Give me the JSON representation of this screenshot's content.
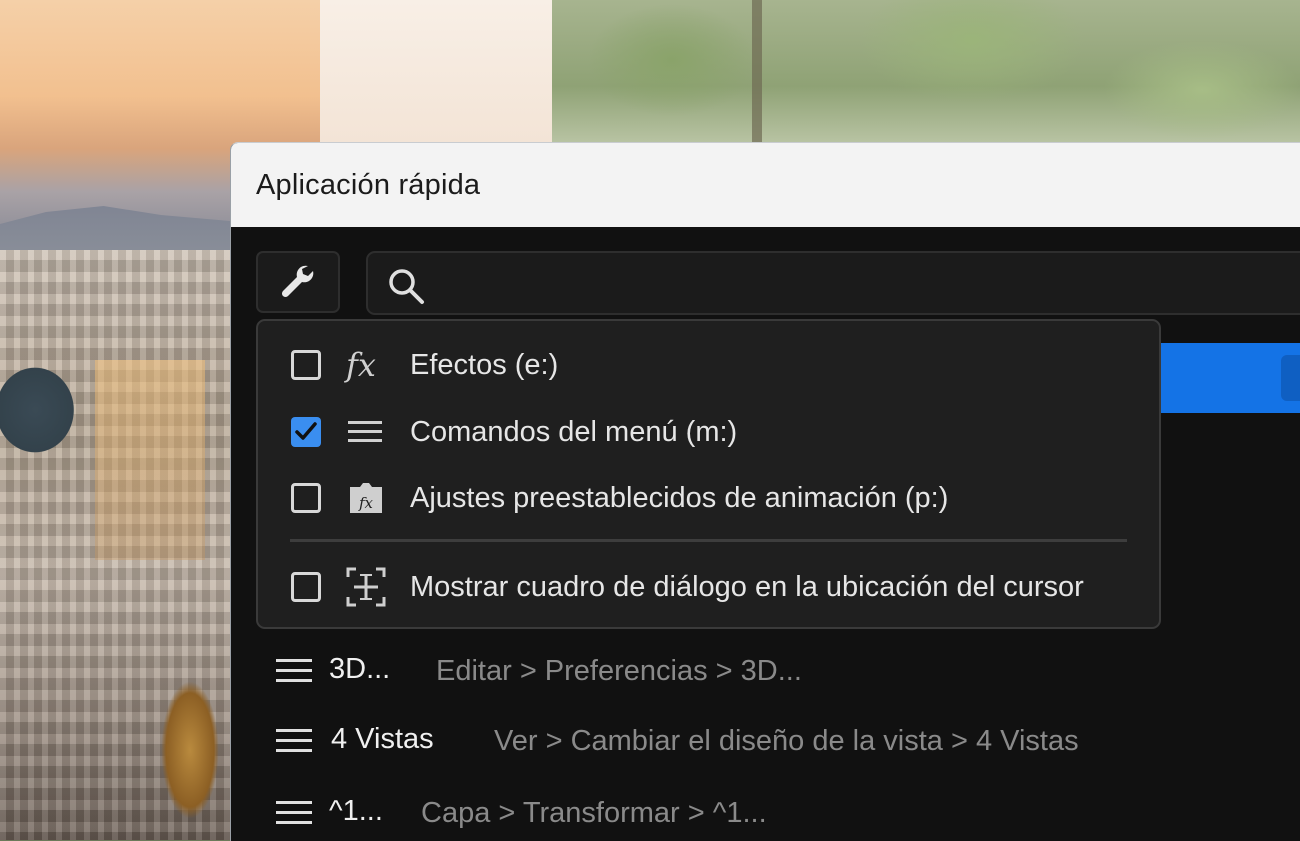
{
  "window": {
    "title": "Aplicación rápida"
  },
  "toolbar": {
    "settings_icon": "wrench-icon",
    "search_icon": "search-icon",
    "search_value": ""
  },
  "filter_menu": {
    "items": [
      {
        "label": "Efectos (e:)",
        "checked": false,
        "icon": "fx-icon"
      },
      {
        "label": "Comandos del menú (m:)",
        "checked": true,
        "icon": "menu-lines-icon"
      },
      {
        "label": "Ajustes preestablecidos de animación (p:)",
        "checked": false,
        "icon": "animation-preset-icon"
      }
    ],
    "option": {
      "label": "Mostrar cuadro de diálogo en la ubicación del cursor",
      "checked": false,
      "icon": "cursor-location-icon"
    }
  },
  "results": [
    {
      "name": "3D...",
      "path": "Editar > Preferencias > 3D...",
      "icon": "menu-lines-icon"
    },
    {
      "name": "4 Vistas",
      "path": "Ver > Cambiar el diseño de la vista > 4 Vistas",
      "icon": "menu-lines-icon"
    },
    {
      "name": "^1...",
      "path": "Capa > Transformar > ^1...",
      "icon": "menu-lines-icon"
    }
  ],
  "colors": {
    "accent": "#1473e6",
    "checkbox_checked": "#3a8ef0",
    "panel_bg": "#111111",
    "menu_bg": "#1f1f1f"
  }
}
